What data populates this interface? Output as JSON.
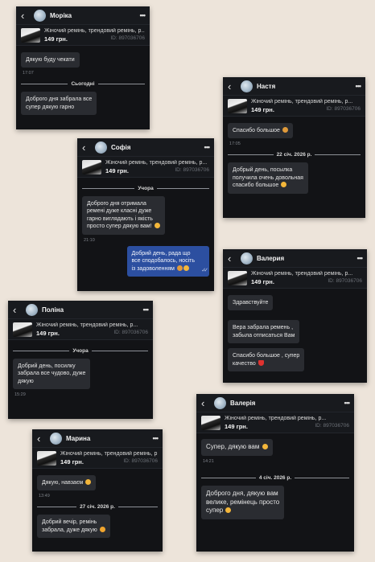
{
  "product": {
    "title": "Жіночий ремінь, трендовий ремінь, р...",
    "price": "149 грн.",
    "id": "ID: 897036706"
  },
  "cards": {
    "morika": {
      "name": "Моріка",
      "msg1": "Дякую буду чекати",
      "time1": "17:07",
      "sep": "Сьогодні",
      "msg2_l1": "Доброго дня забрала все",
      "msg2_l2": "супер дякую гарно"
    },
    "nastya": {
      "name": "Настя",
      "msg1": "Спасибо большое",
      "time1": "17:05",
      "sep": "22 січ. 2026 р.",
      "msg2_l1": "Добрый день, посылка",
      "msg2_l2": "получила очень довольная",
      "msg2_l3": "спасибо большое"
    },
    "sofia": {
      "name": "Софія",
      "sep": "Учора",
      "msg1_l1": "Доброго дня отримала",
      "msg1_l2": "ремені дуже класні дуже",
      "msg1_l3": "гарно виглядають і якість",
      "msg1_l4": "просто супер дякую вам!",
      "time1": "21:10",
      "out_l1": "Добрий день, рада що",
      "out_l2": "все сподобалось, носіть",
      "out_l3": "із задоволенням"
    },
    "valeria1": {
      "name": "Валерия",
      "msg1": "Здравствуйте",
      "msg2_l1": "Вера забрала ремень ,",
      "msg2_l2": "забыла отписаться Вам",
      "msg3_l1": "Спасибо большое , супер",
      "msg3_l2": "качество"
    },
    "polina": {
      "name": "Поліна",
      "sep": "Учора",
      "msg1_l1": "Добрий день, посилку",
      "msg1_l2": "забрала все чудово, дуже",
      "msg1_l3": "дякую",
      "time1": "15:29"
    },
    "valeria2": {
      "name": "Валерія",
      "msg1": "Супер, дякую вам",
      "time1": "14:21",
      "sep": "4 січ. 2026 р.",
      "msg2_l1": "Доброго дня, дякую вам",
      "msg2_l2": "велике, ремінець просто",
      "msg2_l3": "супер"
    },
    "maryna": {
      "name": "Марина",
      "msg1": "Дякую, навзаєм",
      "time1": "13:49",
      "sep": "27 січ. 2026 р.",
      "msg2_l1": "Добрий вечір, ремінь",
      "msg2_l2": "забрала, дуже дякую"
    }
  },
  "icons": {
    "back": "chevron-left-icon",
    "menu": "more-dots-icon",
    "read": "double-check-icon"
  }
}
